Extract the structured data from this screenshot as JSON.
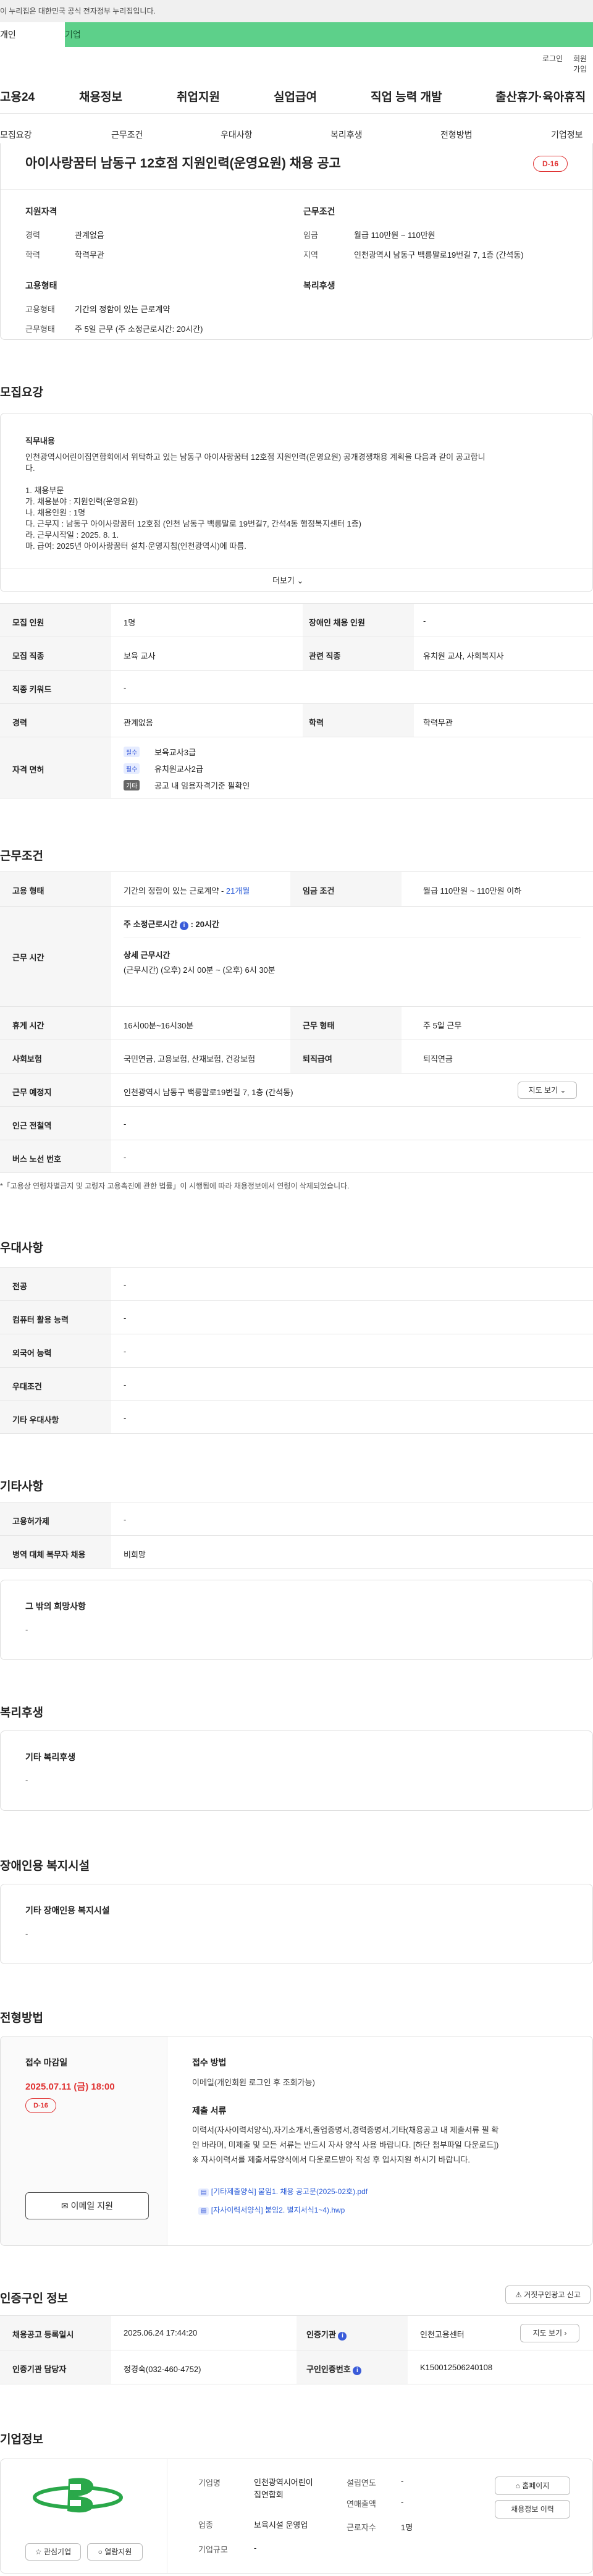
{
  "gov_banner": "이 누리집은 대한민국 공식 전자정부 누리집입니다.",
  "tabs": {
    "personal": "개인",
    "company": "기업"
  },
  "util": {
    "login": "로그인",
    "join": "회원가입"
  },
  "logo": "고용24",
  "gnb": [
    "채용정보",
    "취업지원",
    "실업급여",
    "직업 능력 개발",
    "출산휴가·육아휴직"
  ],
  "subnav": [
    "모집요강",
    "근무조건",
    "우대사항",
    "복리후생",
    "전형방법",
    "기업정보"
  ],
  "job": {
    "title": "아이사랑꿈터 남동구 12호점 지원인력(운영요원) 채용 공고",
    "dday": "D-16",
    "qual_title": "지원자격",
    "cond_title": "근무조건",
    "emp_title": "고용형태",
    "welfare_title": "복리후생",
    "career_label": "경력",
    "career": "관계없음",
    "edu_label": "학력",
    "edu": "학력무관",
    "wage_label": "임금",
    "wage": "월급 110만원 ~ 110만원",
    "loc_label": "지역",
    "loc": "인천광역시 남동구 백릉말로19번길 7, 1층 (간석동)",
    "emptype_label": "고용형태",
    "emptype": "기간의 정함이 있는 근로계약",
    "worktype_label": "근무형태",
    "worktype": "주 5일 근무 (주 소정근로시간: 20시간)"
  },
  "recruit": {
    "section": "모집요강",
    "duty_title": "직무내용",
    "duty_lines": [
      "인천광역시어린이집연합회에서 위탁하고 있는 남동구 아이사랑꿈터 12호점 지원인력(운영요원) 공개경쟁채용 계획을 다음과 같이 공고합니",
      "다.",
      "",
      "1. 채용부문",
      " 가. 채용분야 : 지원인력(운영요원)",
      " 나. 채용인원 : 1명",
      " 다. 근무지 : 남동구 아이사랑꿈터 12호점 (인천 남동구 백릉말로 19번길7, 간석4동 행정복지센터 1층)",
      " 라. 근무시작일 : 2025. 8. 1.",
      " 마. 급여: 2025년 아이사랑꿈터 설치·운영지침(인천광역시)에 따름."
    ],
    "more": "더보기",
    "headcount_label": "모집 인원",
    "headcount": "1명",
    "disabled_label": "장애인 채용 인원",
    "disabled": "-",
    "job_label": "모집 직종",
    "job": "보육 교사",
    "related_label": "관련 직종",
    "related": "유치원 교사, 사회복지사",
    "keyword_label": "직종 키워드",
    "keyword": "-",
    "career_label": "경력",
    "career": "관계없음",
    "edu_label": "학력",
    "edu": "학력무관",
    "license_label": "자격 면허",
    "licenses": [
      {
        "tag": "필수",
        "name": "보육교사3급"
      },
      {
        "tag": "필수",
        "name": "유치원교사2급"
      },
      {
        "tag": "기타",
        "name": "공고 내 임용자격기준 필확인"
      }
    ]
  },
  "work": {
    "section": "근무조건",
    "emptype_label": "고용 형태",
    "emptype": "기간의 정함이 있는 근로계약 - ",
    "emptype_months": "21개월",
    "wage_label": "임금 조건",
    "wage": "월급 110만원 ~ 110만원 이하",
    "hours_label": "근무 시간",
    "weekly": "주 소정근로시간",
    "weekly_val": "20시간",
    "detail_title": "상세 근무시간",
    "detail": "(근무시간) (오후) 2시 00분 ~ (오후) 6시 30분",
    "break_label": "휴게 시간",
    "break": "16시00분~16시30분",
    "form_label": "근무 형태",
    "form": "주 5일 근무",
    "ins_label": "사회보험",
    "ins": "국민연금, 고용보험, 산재보험, 건강보험",
    "ret_label": "퇴직급여",
    "ret": "퇴직연금",
    "place_label": "근무 예정지",
    "place": "인천광역시 남동구 백릉말로19번길 7, 1층 (간석동)",
    "map_btn": "지도 보기",
    "subway_label": "인근 전철역",
    "subway": "-",
    "bus_label": "버스 노선 번호",
    "bus": "-",
    "note": "*「고용상 연령차별금지 및 고령자 고용촉진에 관한 법률」이 시행됨에 따라 채용정보에서 연령이 삭제되었습니다."
  },
  "pref": {
    "section": "우대사항",
    "rows": [
      {
        "label": "전공",
        "value": "-"
      },
      {
        "label": "컴퓨터 활용 능력",
        "value": "-"
      },
      {
        "label": "외국어 능력",
        "value": "-"
      },
      {
        "label": "우대조건",
        "value": "-"
      },
      {
        "label": "기타 우대사항",
        "value": "-"
      }
    ]
  },
  "etc": {
    "section": "기타사항",
    "rows": [
      {
        "label": "고용허가제",
        "value": "-"
      },
      {
        "label": "병역 대체 복무자 채용",
        "value": "비희망"
      }
    ],
    "hope_title": "그 밖의 희망사항",
    "hope": "-"
  },
  "welfare": {
    "section": "복리후생",
    "title": "기타 복리후생",
    "value": "-"
  },
  "disabled_fac": {
    "section": "장애인용 복지시설",
    "title": "기타 장애인용 복지시설",
    "value": "-"
  },
  "process": {
    "section": "전형방법",
    "deadline_title": "접수 마감일",
    "deadline": "2025.07.11 (금) 18:00",
    "dday": "D-16",
    "email_btn": "이메일 지원",
    "method_title": "접수 방법",
    "method": "이메일(개인회원 로그인 후 조회가능)",
    "docs_title": "제출 서류",
    "docs_lines": [
      "이력서(자사이력서양식),자기소개서,졸업증명서,경력증명서,기타(채용공고 내 제출서류 필 확",
      "인 바라며, 미제출 및 모든 서류는 반드시 자사 양식 사용 바랍니다. [하단 첨부파일 다운로드])",
      "※ 자사이력서를 제출서류양식에서 다운로드받아 작성 후 입사지원 하시기 바랍니다."
    ],
    "files": [
      "[기타제출양식] 붙임1. 채용 공고문(2025-02호).pdf",
      "[자사이력서양식] 붙임2. 별지서식1~4).hwp"
    ]
  },
  "cert": {
    "section": "인증구인 정보",
    "report_btn": "거짓구인광고 신고",
    "reg_label": "채용공고 등록일시",
    "reg": "2025.06.24 17:44:20",
    "org_label": "인증기관",
    "org": "인천고용센터",
    "map_btn": "지도 보기",
    "mgr_label": "인증기관 담당자",
    "mgr": "정경숙(032-460-4752)",
    "no_label": "구인인증번호",
    "no": "K150012506240108"
  },
  "company": {
    "section": "기업정보",
    "name_label": "기업명",
    "name_lines": [
      "인천광역시어린이",
      "집연합회"
    ],
    "industry_label": "업종",
    "industry": "보육시설 운영업",
    "scale_label": "기업규모",
    "scale": "-",
    "year_label": "설립연도",
    "year": "-",
    "sales_label": "연매출액",
    "sales": "-",
    "staff_label": "근로자수",
    "staff": "1명",
    "homepage_btn": "홈페이지",
    "jobs_btn": "채용정보 이력",
    "fav_btn": "관심기업",
    "follow_btn": "열람지원"
  }
}
